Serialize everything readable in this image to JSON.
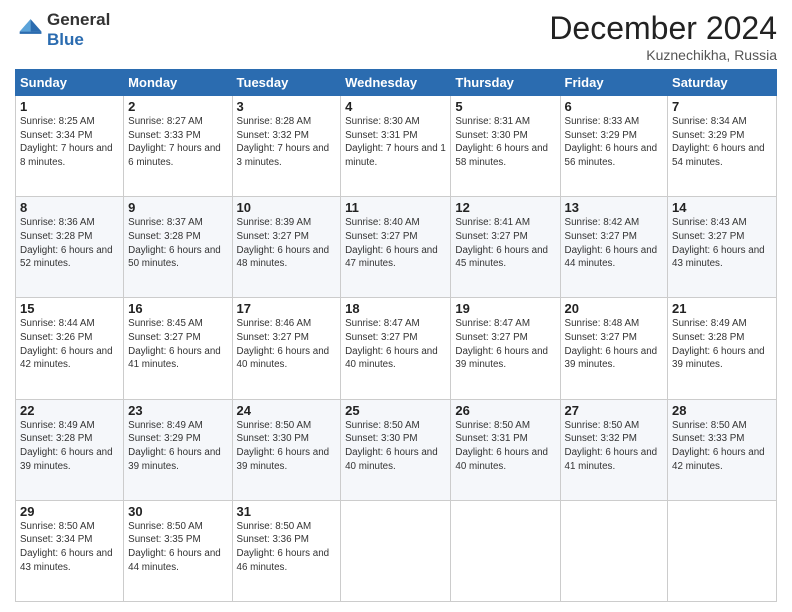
{
  "logo": {
    "line1": "General",
    "line2": "Blue"
  },
  "title": "December 2024",
  "location": "Kuznechikha, Russia",
  "days_of_week": [
    "Sunday",
    "Monday",
    "Tuesday",
    "Wednesday",
    "Thursday",
    "Friday",
    "Saturday"
  ],
  "weeks": [
    [
      {
        "day": "1",
        "sunrise": "8:25 AM",
        "sunset": "3:34 PM",
        "daylight": "7 hours and 8 minutes."
      },
      {
        "day": "2",
        "sunrise": "8:27 AM",
        "sunset": "3:33 PM",
        "daylight": "7 hours and 6 minutes."
      },
      {
        "day": "3",
        "sunrise": "8:28 AM",
        "sunset": "3:32 PM",
        "daylight": "7 hours and 3 minutes."
      },
      {
        "day": "4",
        "sunrise": "8:30 AM",
        "sunset": "3:31 PM",
        "daylight": "7 hours and 1 minute."
      },
      {
        "day": "5",
        "sunrise": "8:31 AM",
        "sunset": "3:30 PM",
        "daylight": "6 hours and 58 minutes."
      },
      {
        "day": "6",
        "sunrise": "8:33 AM",
        "sunset": "3:29 PM",
        "daylight": "6 hours and 56 minutes."
      },
      {
        "day": "7",
        "sunrise": "8:34 AM",
        "sunset": "3:29 PM",
        "daylight": "6 hours and 54 minutes."
      }
    ],
    [
      {
        "day": "8",
        "sunrise": "8:36 AM",
        "sunset": "3:28 PM",
        "daylight": "6 hours and 52 minutes."
      },
      {
        "day": "9",
        "sunrise": "8:37 AM",
        "sunset": "3:28 PM",
        "daylight": "6 hours and 50 minutes."
      },
      {
        "day": "10",
        "sunrise": "8:39 AM",
        "sunset": "3:27 PM",
        "daylight": "6 hours and 48 minutes."
      },
      {
        "day": "11",
        "sunrise": "8:40 AM",
        "sunset": "3:27 PM",
        "daylight": "6 hours and 47 minutes."
      },
      {
        "day": "12",
        "sunrise": "8:41 AM",
        "sunset": "3:27 PM",
        "daylight": "6 hours and 45 minutes."
      },
      {
        "day": "13",
        "sunrise": "8:42 AM",
        "sunset": "3:27 PM",
        "daylight": "6 hours and 44 minutes."
      },
      {
        "day": "14",
        "sunrise": "8:43 AM",
        "sunset": "3:27 PM",
        "daylight": "6 hours and 43 minutes."
      }
    ],
    [
      {
        "day": "15",
        "sunrise": "8:44 AM",
        "sunset": "3:26 PM",
        "daylight": "6 hours and 42 minutes."
      },
      {
        "day": "16",
        "sunrise": "8:45 AM",
        "sunset": "3:27 PM",
        "daylight": "6 hours and 41 minutes."
      },
      {
        "day": "17",
        "sunrise": "8:46 AM",
        "sunset": "3:27 PM",
        "daylight": "6 hours and 40 minutes."
      },
      {
        "day": "18",
        "sunrise": "8:47 AM",
        "sunset": "3:27 PM",
        "daylight": "6 hours and 40 minutes."
      },
      {
        "day": "19",
        "sunrise": "8:47 AM",
        "sunset": "3:27 PM",
        "daylight": "6 hours and 39 minutes."
      },
      {
        "day": "20",
        "sunrise": "8:48 AM",
        "sunset": "3:27 PM",
        "daylight": "6 hours and 39 minutes."
      },
      {
        "day": "21",
        "sunrise": "8:49 AM",
        "sunset": "3:28 PM",
        "daylight": "6 hours and 39 minutes."
      }
    ],
    [
      {
        "day": "22",
        "sunrise": "8:49 AM",
        "sunset": "3:28 PM",
        "daylight": "6 hours and 39 minutes."
      },
      {
        "day": "23",
        "sunrise": "8:49 AM",
        "sunset": "3:29 PM",
        "daylight": "6 hours and 39 minutes."
      },
      {
        "day": "24",
        "sunrise": "8:50 AM",
        "sunset": "3:30 PM",
        "daylight": "6 hours and 39 minutes."
      },
      {
        "day": "25",
        "sunrise": "8:50 AM",
        "sunset": "3:30 PM",
        "daylight": "6 hours and 40 minutes."
      },
      {
        "day": "26",
        "sunrise": "8:50 AM",
        "sunset": "3:31 PM",
        "daylight": "6 hours and 40 minutes."
      },
      {
        "day": "27",
        "sunrise": "8:50 AM",
        "sunset": "3:32 PM",
        "daylight": "6 hours and 41 minutes."
      },
      {
        "day": "28",
        "sunrise": "8:50 AM",
        "sunset": "3:33 PM",
        "daylight": "6 hours and 42 minutes."
      }
    ],
    [
      {
        "day": "29",
        "sunrise": "8:50 AM",
        "sunset": "3:34 PM",
        "daylight": "6 hours and 43 minutes."
      },
      {
        "day": "30",
        "sunrise": "8:50 AM",
        "sunset": "3:35 PM",
        "daylight": "6 hours and 44 minutes."
      },
      {
        "day": "31",
        "sunrise": "8:50 AM",
        "sunset": "3:36 PM",
        "daylight": "6 hours and 46 minutes."
      },
      null,
      null,
      null,
      null
    ]
  ]
}
